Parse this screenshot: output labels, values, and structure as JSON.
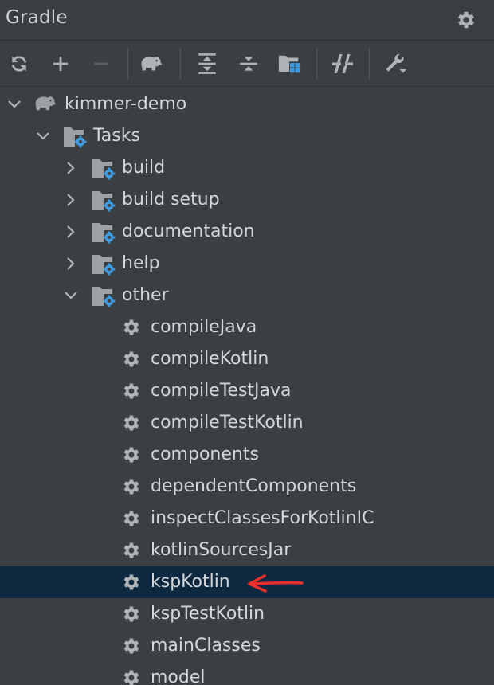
{
  "panel": {
    "title": "Gradle",
    "icons": {
      "settings": "gear-icon"
    }
  },
  "toolbar": {
    "buttons": [
      {
        "name": "reload-all-gradle-projects",
        "icon": "refresh-icon"
      },
      {
        "name": "link-gradle-project",
        "icon": "plus-icon"
      },
      {
        "name": "unlink-gradle-project",
        "icon": "minus-icon",
        "disabled": true
      },
      {
        "name": "execute-gradle-task",
        "icon": "elephant-icon"
      },
      {
        "name": "expand-all",
        "icon": "expand-all-icon"
      },
      {
        "name": "collapse-all",
        "icon": "collapse-all-icon"
      },
      {
        "name": "analyze-dependencies",
        "icon": "folder-grid-icon"
      },
      {
        "name": "toggle-offline-mode",
        "icon": "offline-icon"
      },
      {
        "name": "build-tool-settings",
        "icon": "wrench-icon"
      }
    ]
  },
  "tree": {
    "project": {
      "label": "kimmer-demo",
      "expanded": true,
      "icon": "elephant-icon"
    },
    "tasks_folder": {
      "label": "Tasks",
      "expanded": true,
      "icon": "folder-gear-icon"
    },
    "groups": [
      {
        "label": "build",
        "expanded": false
      },
      {
        "label": "build setup",
        "expanded": false
      },
      {
        "label": "documentation",
        "expanded": false
      },
      {
        "label": "help",
        "expanded": false
      },
      {
        "label": "other",
        "expanded": true
      }
    ],
    "tasks": [
      {
        "label": "compileJava"
      },
      {
        "label": "compileKotlin"
      },
      {
        "label": "compileTestJava"
      },
      {
        "label": "compileTestKotlin"
      },
      {
        "label": "components"
      },
      {
        "label": "dependentComponents"
      },
      {
        "label": "inspectClassesForKotlinIC"
      },
      {
        "label": "kotlinSourcesJar"
      },
      {
        "label": "kspKotlin",
        "selected": true
      },
      {
        "label": "kspTestKotlin"
      },
      {
        "label": "mainClasses"
      },
      {
        "label": "model"
      }
    ]
  },
  "annotation": {
    "type": "arrow",
    "color": "#e8302a",
    "points_to": "kspKotlin"
  },
  "colors": {
    "background": "#3c3f41",
    "selection": "#0e293f",
    "text": "#d4d7da",
    "icon_gray": "#aeb3b8",
    "gear_badge_blue": "#3d9be0",
    "annotation_red": "#e8302a"
  }
}
